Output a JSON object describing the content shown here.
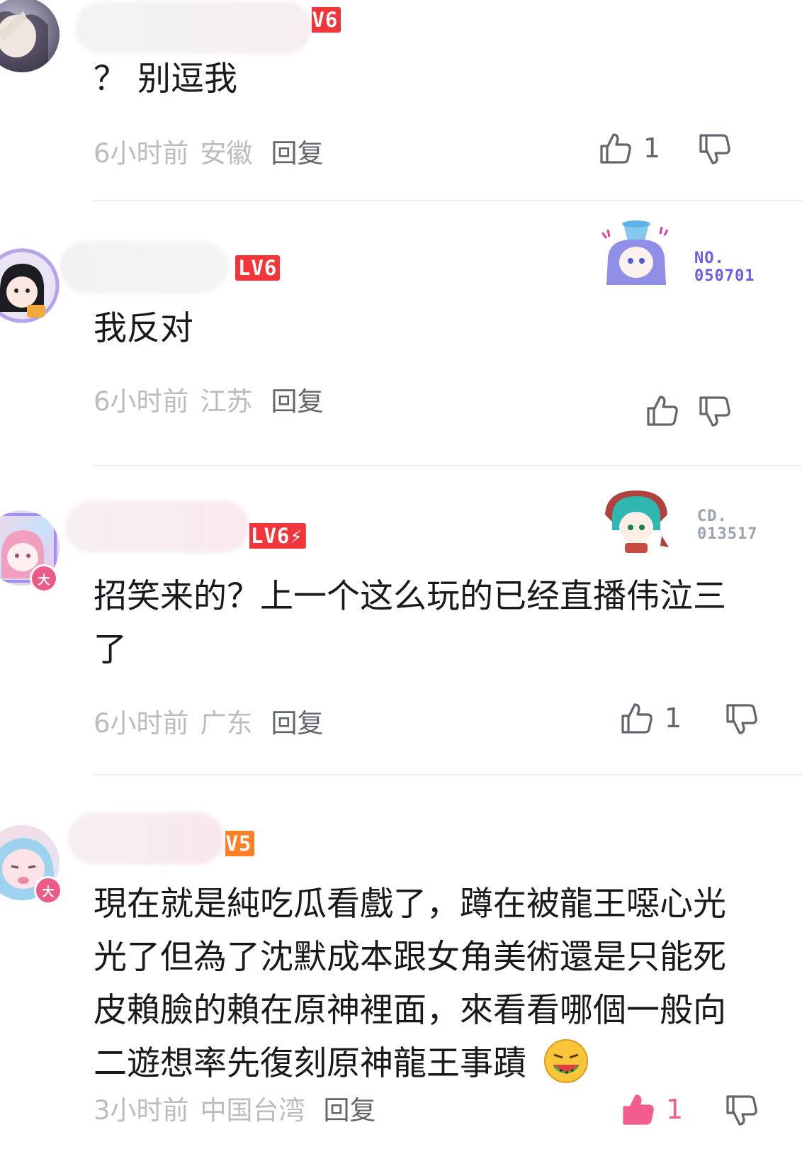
{
  "comments": [
    {
      "level": "LV6",
      "text_lines": [
        "？ 别逗我"
      ],
      "time": "6小时前",
      "region": "安徽",
      "reply_label": "回复",
      "likes": "1"
    },
    {
      "level": "LV6",
      "fan_badge": {
        "line1": "NO.",
        "line2": "050701",
        "color": "#6a5be8"
      },
      "text_lines": [
        "我反对"
      ],
      "time": "6小时前",
      "region": "江苏",
      "reply_label": "回复",
      "likes": ""
    },
    {
      "level": "LV6",
      "fan_badge": {
        "line1": "CD.",
        "line2": "013517",
        "color": "#9aa3ad"
      },
      "avatar_badge": "大",
      "text_lines": [
        "招笑来的？上一个这么玩的已经直播伟泣三",
        "了"
      ],
      "time": "6小时前",
      "region": "广东",
      "reply_label": "回复",
      "likes": "1"
    },
    {
      "level": "LV5",
      "avatar_badge": "大",
      "text_lines": [
        "現在就是純吃瓜看戲了，蹲在被龍王噁心光",
        "光了但為了沈默成本跟女角美術還是只能死",
        "皮賴臉的賴在原神裡面，來看看哪個一般向",
        "二遊想率先復刻原神龍王事蹟"
      ],
      "time": "3小时前",
      "region": "中国台湾",
      "reply_label": "回复",
      "likes": "1"
    }
  ],
  "colors": {
    "lv6": "#f0363a",
    "lv5": "#ff7f24",
    "meta_gray": "#b9bcc1",
    "icon_gray": "#61666d"
  }
}
